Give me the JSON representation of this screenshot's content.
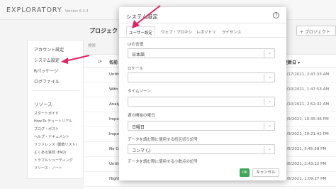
{
  "app": {
    "name": "EXPLORATORY",
    "version": "Version 6.3.4"
  },
  "colors": {
    "accent": "#e0245e",
    "ok": "#3aa757"
  },
  "main": {
    "title": "プロジェクト",
    "new_project": "+ プロジェクト",
    "search_label": "検索",
    "col_name": "名前",
    "col_updated": "更新日 ▾",
    "rows": [
      {
        "name": "Untitl",
        "date": "5/17/2021, 2:47:33 AM"
      },
      {
        "name": "With",
        "date": "5/10/2021, 1:47:53 AM"
      },
      {
        "name": "Analy",
        "date": "5/10/2021, 2:52:32 AM"
      },
      {
        "name": "Impo",
        "date": "5/9/2021, 10:35:46 PM"
      },
      {
        "name": "Impo",
        "date": "5/9/2021, 10:21:42 PM"
      },
      {
        "name": "No Co",
        "date": "5/8/2021, 5:45:58 PM"
      },
      {
        "name": "Untitl",
        "date": "5/8/2021, 2:43:22 PM"
      },
      {
        "name": "Highlight list",
        "date": "5/8/2021, 1:09:27 PM"
      }
    ]
  },
  "sidebar": {
    "account": "アカウント設定",
    "system": "システム設定",
    "packages": "Rパッケージ",
    "logs": "ログファイル",
    "resources_head": "リソース",
    "resources": [
      "スタートガイド",
      "How-To チュートリアル",
      "ブログ・ポスト",
      "ヘルプ・ドキュメント",
      "リファレンス (関数リスト)",
      "よくある質問 (FAQ)",
      "トラブルシューティング",
      "リリース・ノート"
    ]
  },
  "modal": {
    "title": "システム設定",
    "help": "?",
    "tabs": [
      "ユーザー設定",
      "ウェブ・プロキシ",
      "レポジトリ",
      "ライセンス"
    ],
    "fields": {
      "ui_lang_label": "UIの言語",
      "ui_lang_value": "日本語",
      "locale_label": "ロケール",
      "locale_value": "",
      "timezone_label": "タイムゾーン",
      "timezone_value": "",
      "week_start_label": "週の開始の曜日",
      "week_start_value": "日曜日",
      "thousand_sep_label": "データを読む際に使用する桁区切り記号",
      "thousand_sep_value": "コンマ (,)",
      "decimal_label": "データを読む際に使用する小数点の記号"
    },
    "ok": "OK",
    "cancel": "キャンセル"
  }
}
